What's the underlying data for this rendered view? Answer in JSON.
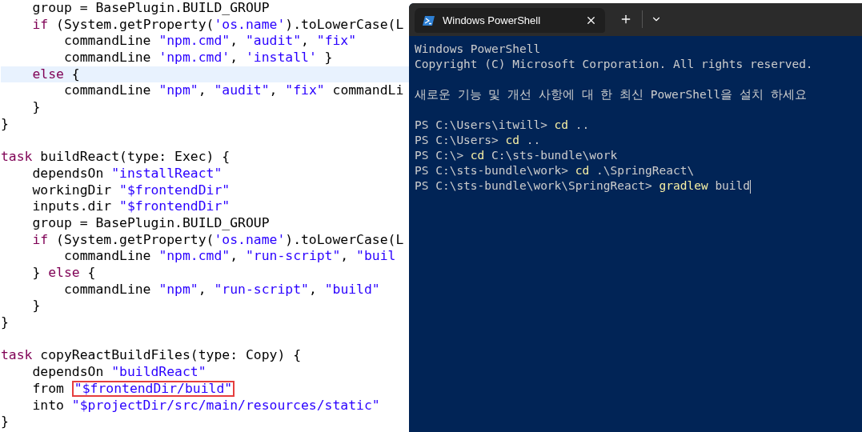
{
  "editor": {
    "lines": [
      {
        "kind": "code",
        "current": false,
        "segments": [
          {
            "kind": "plain",
            "text": "    group = BasePlugin.BUILD_GROUP"
          }
        ]
      },
      {
        "kind": "code",
        "current": false,
        "segments": [
          {
            "kind": "keyword",
            "text": "    if"
          },
          {
            "kind": "plain",
            "text": " (System.getProperty("
          },
          {
            "kind": "string",
            "text": "'os.name'"
          },
          {
            "kind": "plain",
            "text": ").toLowerCase(L"
          }
        ]
      },
      {
        "kind": "code",
        "current": false,
        "segments": [
          {
            "kind": "plain",
            "text": "        commandLine "
          },
          {
            "kind": "string",
            "text": "\"npm.cmd\""
          },
          {
            "kind": "plain",
            "text": ", "
          },
          {
            "kind": "string",
            "text": "\"audit\""
          },
          {
            "kind": "plain",
            "text": ", "
          },
          {
            "kind": "string",
            "text": "\"fix\""
          }
        ]
      },
      {
        "kind": "code",
        "current": false,
        "segments": [
          {
            "kind": "plain",
            "text": "        commandLine "
          },
          {
            "kind": "string",
            "text": "'npm.cmd'"
          },
          {
            "kind": "plain",
            "text": ", "
          },
          {
            "kind": "string",
            "text": "'install'"
          },
          {
            "kind": "plain",
            "text": " }"
          }
        ]
      },
      {
        "kind": "code",
        "current": true,
        "segments": [
          {
            "kind": "keyword",
            "text": "    else"
          },
          {
            "kind": "plain",
            "text": " {"
          }
        ]
      },
      {
        "kind": "code",
        "current": false,
        "segments": [
          {
            "kind": "plain",
            "text": "        commandLine "
          },
          {
            "kind": "string",
            "text": "\"npm\""
          },
          {
            "kind": "plain",
            "text": ", "
          },
          {
            "kind": "string",
            "text": "\"audit\""
          },
          {
            "kind": "plain",
            "text": ", "
          },
          {
            "kind": "string",
            "text": "\"fix\""
          },
          {
            "kind": "plain",
            "text": " commandLi"
          }
        ]
      },
      {
        "kind": "code",
        "current": false,
        "segments": [
          {
            "kind": "plain",
            "text": "    }"
          }
        ]
      },
      {
        "kind": "code",
        "current": false,
        "segments": [
          {
            "kind": "plain",
            "text": "}"
          }
        ]
      },
      {
        "kind": "blank",
        "current": false
      },
      {
        "kind": "code",
        "current": false,
        "segments": [
          {
            "kind": "keyword",
            "text": "task"
          },
          {
            "kind": "plain",
            "text": " buildReact(type: Exec) {"
          }
        ]
      },
      {
        "kind": "code",
        "current": false,
        "segments": [
          {
            "kind": "plain",
            "text": "    dependsOn "
          },
          {
            "kind": "string",
            "text": "\"installReact\""
          }
        ]
      },
      {
        "kind": "code",
        "current": false,
        "segments": [
          {
            "kind": "plain",
            "text": "    workingDir "
          },
          {
            "kind": "string",
            "text": "\"$frontendDir\""
          }
        ]
      },
      {
        "kind": "code",
        "current": false,
        "segments": [
          {
            "kind": "plain",
            "text": "    inputs.dir "
          },
          {
            "kind": "string",
            "text": "\"$frontendDir\""
          }
        ]
      },
      {
        "kind": "code",
        "current": false,
        "segments": [
          {
            "kind": "plain",
            "text": "    group = BasePlugin.BUILD_GROUP"
          }
        ]
      },
      {
        "kind": "code",
        "current": false,
        "segments": [
          {
            "kind": "keyword",
            "text": "    if"
          },
          {
            "kind": "plain",
            "text": " (System.getProperty("
          },
          {
            "kind": "string",
            "text": "'os.name'"
          },
          {
            "kind": "plain",
            "text": ").toLowerCase(L"
          }
        ]
      },
      {
        "kind": "code",
        "current": false,
        "segments": [
          {
            "kind": "plain",
            "text": "        commandLine "
          },
          {
            "kind": "string",
            "text": "\"npm.cmd\""
          },
          {
            "kind": "plain",
            "text": ", "
          },
          {
            "kind": "string",
            "text": "\"run-script\""
          },
          {
            "kind": "plain",
            "text": ", "
          },
          {
            "kind": "string",
            "text": "\"buil"
          }
        ]
      },
      {
        "kind": "code",
        "current": false,
        "segments": [
          {
            "kind": "plain",
            "text": "    } "
          },
          {
            "kind": "keyword",
            "text": "else"
          },
          {
            "kind": "plain",
            "text": " {"
          }
        ]
      },
      {
        "kind": "code",
        "current": false,
        "segments": [
          {
            "kind": "plain",
            "text": "        commandLine "
          },
          {
            "kind": "string",
            "text": "\"npm\""
          },
          {
            "kind": "plain",
            "text": ", "
          },
          {
            "kind": "string",
            "text": "\"run-script\""
          },
          {
            "kind": "plain",
            "text": ", "
          },
          {
            "kind": "string",
            "text": "\"build\""
          }
        ]
      },
      {
        "kind": "code",
        "current": false,
        "segments": [
          {
            "kind": "plain",
            "text": "    }"
          }
        ]
      },
      {
        "kind": "code",
        "current": false,
        "segments": [
          {
            "kind": "plain",
            "text": "}"
          }
        ]
      },
      {
        "kind": "blank",
        "current": false
      },
      {
        "kind": "code",
        "current": false,
        "segments": [
          {
            "kind": "keyword",
            "text": "task"
          },
          {
            "kind": "plain",
            "text": " copyReactBuildFiles(type: Copy) {"
          }
        ]
      },
      {
        "kind": "code",
        "current": false,
        "segments": [
          {
            "kind": "plain",
            "text": "    dependsOn "
          },
          {
            "kind": "string",
            "text": "\"buildReact\""
          }
        ]
      },
      {
        "kind": "code",
        "current": false,
        "segments": [
          {
            "kind": "plain",
            "text": "    from "
          },
          {
            "kind": "boxed",
            "text": "\"$frontendDir/build\""
          }
        ]
      },
      {
        "kind": "code",
        "current": false,
        "segments": [
          {
            "kind": "plain",
            "text": "    into "
          },
          {
            "kind": "string",
            "text": "\"$projectDir/src/main/resources/static\""
          }
        ]
      },
      {
        "kind": "code",
        "current": false,
        "segments": [
          {
            "kind": "plain",
            "text": "}"
          }
        ]
      }
    ]
  },
  "terminal": {
    "tab_title": "Windows PowerShell",
    "lines": [
      {
        "kind": "text",
        "segments": [
          {
            "kind": "output",
            "text": "Windows PowerShell"
          }
        ]
      },
      {
        "kind": "text",
        "segments": [
          {
            "kind": "output",
            "text": "Copyright (C) Microsoft Corporation. All rights reserved."
          }
        ]
      },
      {
        "kind": "blank"
      },
      {
        "kind": "text",
        "segments": [
          {
            "kind": "output",
            "text": "새로운 기능 및 개선 사항에 대 한 최신 PowerShell을 설치 하세요"
          }
        ]
      },
      {
        "kind": "blank"
      },
      {
        "kind": "text",
        "segments": [
          {
            "kind": "output",
            "text": "PS C:\\Users\\itwill> "
          },
          {
            "kind": "command",
            "text": "cd"
          },
          {
            "kind": "output",
            "text": " .."
          }
        ]
      },
      {
        "kind": "text",
        "segments": [
          {
            "kind": "output",
            "text": "PS C:\\Users> "
          },
          {
            "kind": "command",
            "text": "cd"
          },
          {
            "kind": "output",
            "text": " .."
          }
        ]
      },
      {
        "kind": "text",
        "segments": [
          {
            "kind": "output",
            "text": "PS C:\\> "
          },
          {
            "kind": "command",
            "text": "cd"
          },
          {
            "kind": "output",
            "text": " C:\\sts-bundle\\work"
          }
        ]
      },
      {
        "kind": "text",
        "segments": [
          {
            "kind": "output",
            "text": "PS C:\\sts-bundle\\work> "
          },
          {
            "kind": "command",
            "text": "cd"
          },
          {
            "kind": "output",
            "text": " .\\SpringReact\\"
          }
        ]
      },
      {
        "kind": "text",
        "segments": [
          {
            "kind": "output",
            "text": "PS C:\\sts-bundle\\work\\SpringReact> "
          },
          {
            "kind": "command",
            "text": "gradlew"
          },
          {
            "kind": "output",
            "text": " build"
          }
        ]
      }
    ]
  }
}
